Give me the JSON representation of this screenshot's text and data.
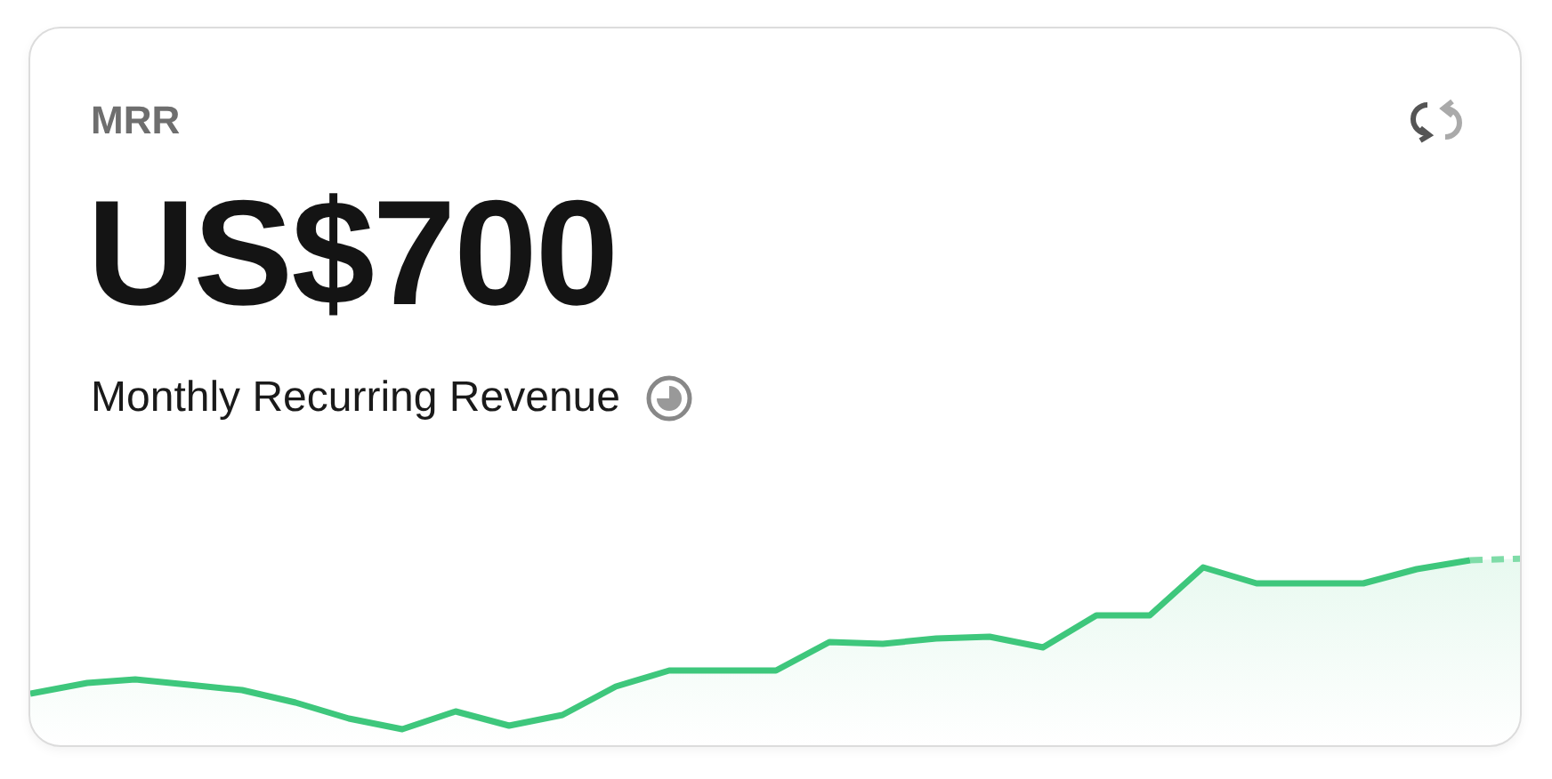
{
  "card": {
    "title": "MRR",
    "value": "US$700",
    "caption": "Monthly Recurring Revenue"
  }
}
